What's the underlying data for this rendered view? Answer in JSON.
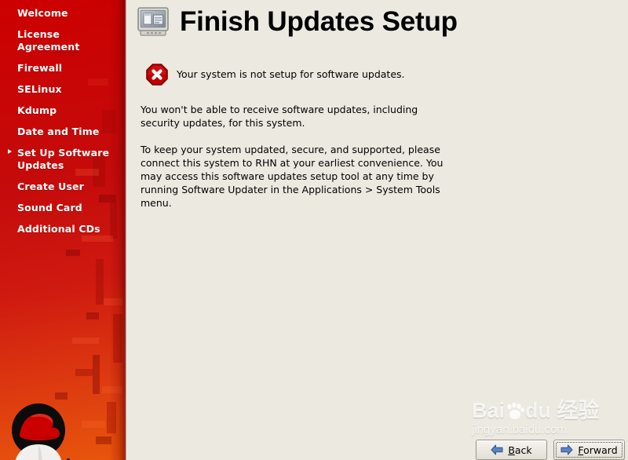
{
  "window": {
    "background_color": "#ece9e1"
  },
  "sidebar": {
    "brand_color": "#cc0000",
    "accent_color": "#e8560c",
    "logo_name": "red-hat-shadowman-logo",
    "items": [
      {
        "label": "Welcome",
        "current": false
      },
      {
        "label": "License Agreement",
        "current": false
      },
      {
        "label": "Firewall",
        "current": false
      },
      {
        "label": "SELinux",
        "current": false
      },
      {
        "label": "Kdump",
        "current": false
      },
      {
        "label": "Date and Time",
        "current": false
      },
      {
        "label": "Set Up Software Updates",
        "current": true
      },
      {
        "label": "Create User",
        "current": false
      },
      {
        "label": "Sound Card",
        "current": false
      },
      {
        "label": "Additional CDs",
        "current": false
      }
    ]
  },
  "header": {
    "title": "Finish Updates Setup",
    "icon": "monitor-icon"
  },
  "status": {
    "icon": "error-stop-icon",
    "icon_color": "#cc0000",
    "message": "Your system is not setup for software updates."
  },
  "body": {
    "paragraphs": [
      "You won't be able to receive software updates, including security updates, for this system.",
      "To keep your system updated, secure, and supported, please connect this system to RHN at your earliest convenience. You may access this software updates setup tool at any time by running Software Updater in the Applications > System Tools menu."
    ]
  },
  "watermark": {
    "logo_text_a": "Bai",
    "logo_text_b": "du",
    "logo_text_c": "经验",
    "url": "jingyan.baidu.com"
  },
  "buttons": {
    "back": {
      "label_prefix": "",
      "mnemonic": "B",
      "label_suffix": "ack",
      "icon": "arrow-left-icon",
      "focused": false
    },
    "forward": {
      "label_prefix": "",
      "mnemonic": "F",
      "label_suffix": "orward",
      "icon": "arrow-right-icon",
      "focused": true
    }
  }
}
